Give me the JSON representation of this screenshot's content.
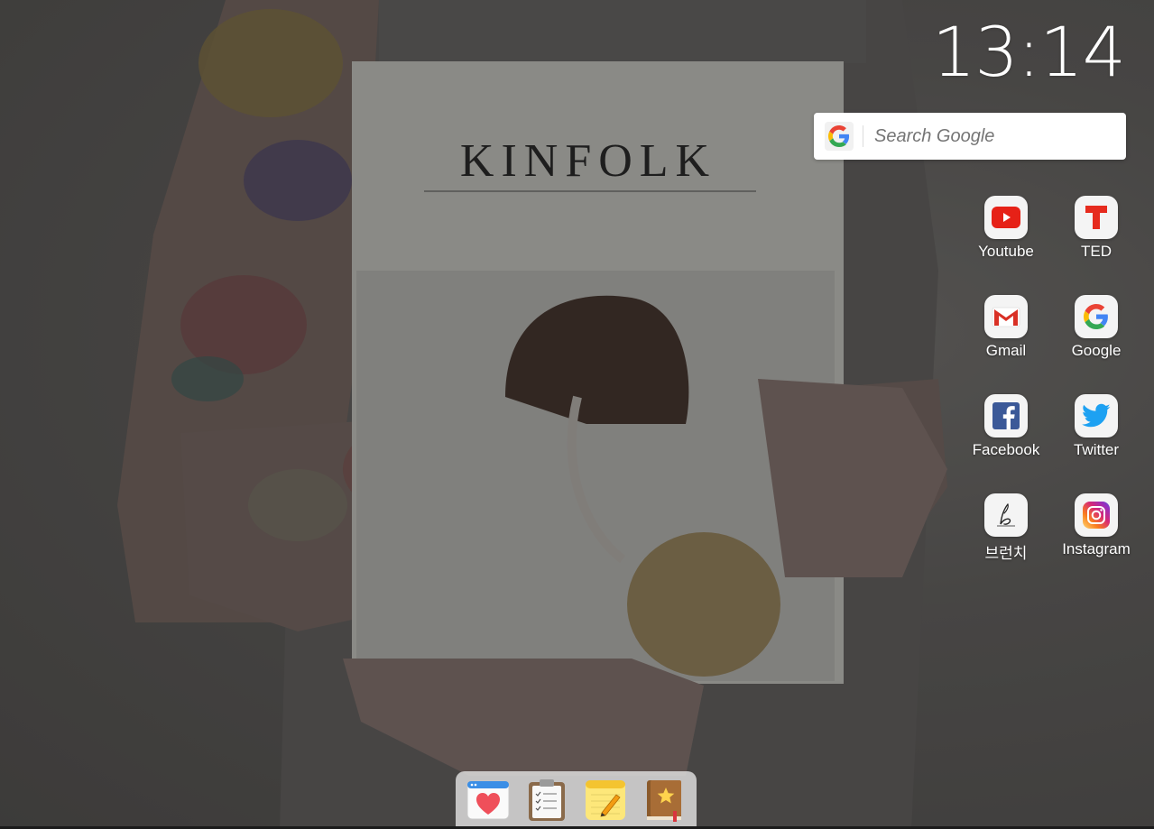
{
  "clock": {
    "time": "13:14"
  },
  "search": {
    "placeholder": "Search Google",
    "icon": "google-g-icon"
  },
  "shortcuts": [
    {
      "label": "Youtube",
      "icon": "youtube-icon",
      "color": "#e62117"
    },
    {
      "label": "TED",
      "icon": "ted-icon",
      "color": "#e62b1e"
    },
    {
      "label": "Gmail",
      "icon": "gmail-icon",
      "color": "#d93025"
    },
    {
      "label": "Google",
      "icon": "google-icon",
      "color": "#4285f4"
    },
    {
      "label": "Facebook",
      "icon": "facebook-icon",
      "color": "#3b5998"
    },
    {
      "label": "Twitter",
      "icon": "twitter-icon",
      "color": "#1da1f2"
    },
    {
      "label": "브런치",
      "icon": "brunch-icon",
      "color": "#222222"
    },
    {
      "label": "Instagram",
      "icon": "instagram-icon",
      "color": "#c13584"
    }
  ],
  "dock": [
    {
      "icon": "favorites-heart-icon"
    },
    {
      "icon": "clipboard-checklist-icon"
    },
    {
      "icon": "notes-pencil-icon"
    },
    {
      "icon": "bookmark-book-star-icon"
    }
  ],
  "wallpaper": {
    "text": "KINFOLK"
  }
}
